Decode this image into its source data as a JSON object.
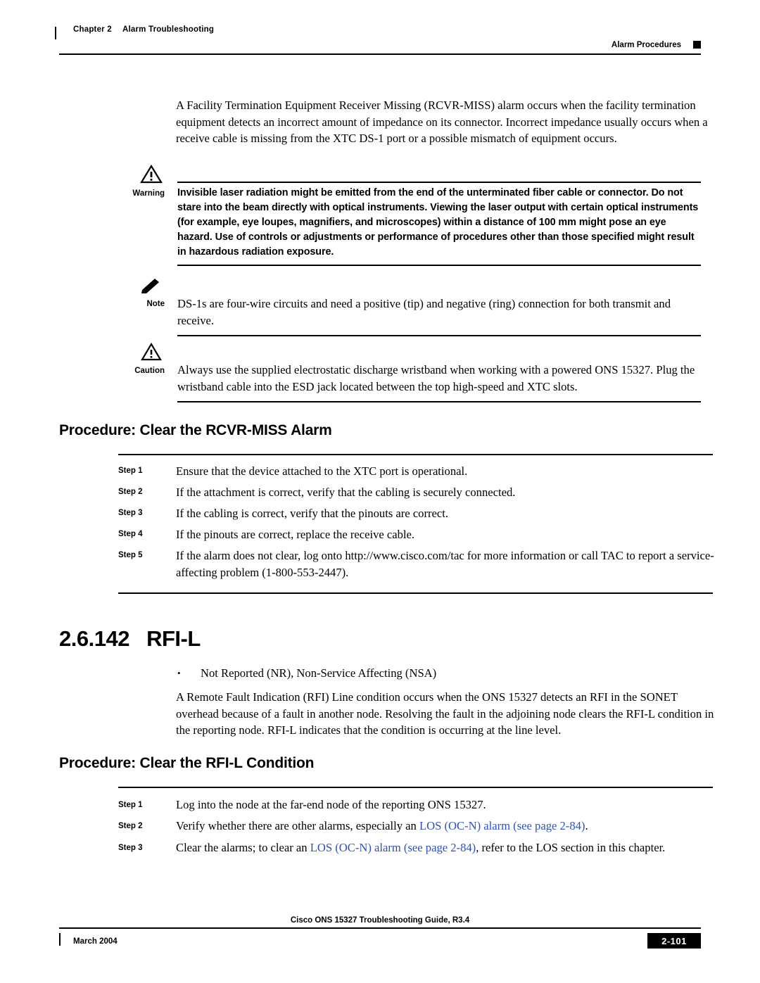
{
  "header": {
    "chapter_label": "Chapter 2",
    "chapter_title": "Alarm Troubleshooting",
    "right_label": "Alarm Procedures"
  },
  "intro_paragraph": "A Facility Termination Equipment Receiver Missing (RCVR-MISS) alarm occurs when the facility termination equipment detects an incorrect amount of impedance on its connector. Incorrect impedance usually occurs when a receive cable is missing from the XTC DS-1 port or a possible mismatch of equipment occurs.",
  "warning": {
    "label": "Warning",
    "icon": "warning-triangle-icon",
    "text": "Invisible laser radiation might be emitted from the end of the unterminated fiber cable or connector. Do not stare into the beam directly with optical instruments. Viewing the laser output with certain optical instruments (for example, eye loupes, magnifiers, and microscopes) within a distance of 100 mm might pose an eye hazard. Use of controls or adjustments or performance of procedures other than those specified might result in hazardous radiation exposure."
  },
  "note": {
    "label": "Note",
    "icon": "note-pencil-icon",
    "text": "DS-1s are four-wire circuits and need a positive (tip) and negative (ring) connection for both transmit and receive."
  },
  "caution": {
    "label": "Caution",
    "icon": "caution-triangle-icon",
    "text": "Always use the supplied electrostatic discharge wristband when working with a powered ONS 15327. Plug the wristband cable into the ESD jack located between the top high-speed and XTC slots."
  },
  "procedure1": {
    "heading": "Procedure: Clear the RCVR-MISS Alarm",
    "steps": [
      {
        "label": "Step 1",
        "text": "Ensure that the device attached to the XTC port is operational."
      },
      {
        "label": "Step 2",
        "text": "If the attachment is correct, verify that the cabling is securely connected."
      },
      {
        "label": "Step 3",
        "text": "If the cabling is correct, verify that the pinouts are correct."
      },
      {
        "label": "Step 4",
        "text": "If the pinouts are correct, replace the receive cable."
      },
      {
        "label": "Step 5",
        "text": "If the alarm does not clear, log onto http://www.cisco.com/tac for more information or call TAC to report a service-affecting problem (1-800-553-2447)."
      }
    ]
  },
  "section": {
    "number": "2.6.142",
    "title": "RFI-L",
    "bullet": "Not Reported (NR), Non-Service Affecting (NSA)",
    "paragraph": "A Remote Fault Indication (RFI) Line condition occurs when the ONS 15327 detects an RFI in the SONET overhead because of a fault in another node. Resolving the fault in the adjoining node clears the RFI-L condition in the reporting node. RFI-L indicates that the condition is occurring at the line level."
  },
  "procedure2": {
    "heading": "Procedure: Clear the RFI-L Condition",
    "step1_label": "Step 1",
    "step1_text": "Log into the node at the far-end node of the reporting ONS 15327.",
    "step2_label": "Step 2",
    "step2_pre": "Verify whether there are other alarms, especially an ",
    "step2_link": "LOS (OC-N) alarm (see page 2-84)",
    "step2_post": ".",
    "step3_label": "Step 3",
    "step3_pre": "Clear the alarms; to clear an ",
    "step3_link": "LOS (OC-N) alarm (see page 2-84)",
    "step3_post": ", refer to the LOS section in this chapter."
  },
  "footer": {
    "guide": "Cisco ONS 15327 Troubleshooting Guide, R3.4",
    "date": "March 2004",
    "page": "2-101"
  },
  "colors": {
    "link": "#2b52c4",
    "text": "#000000"
  }
}
